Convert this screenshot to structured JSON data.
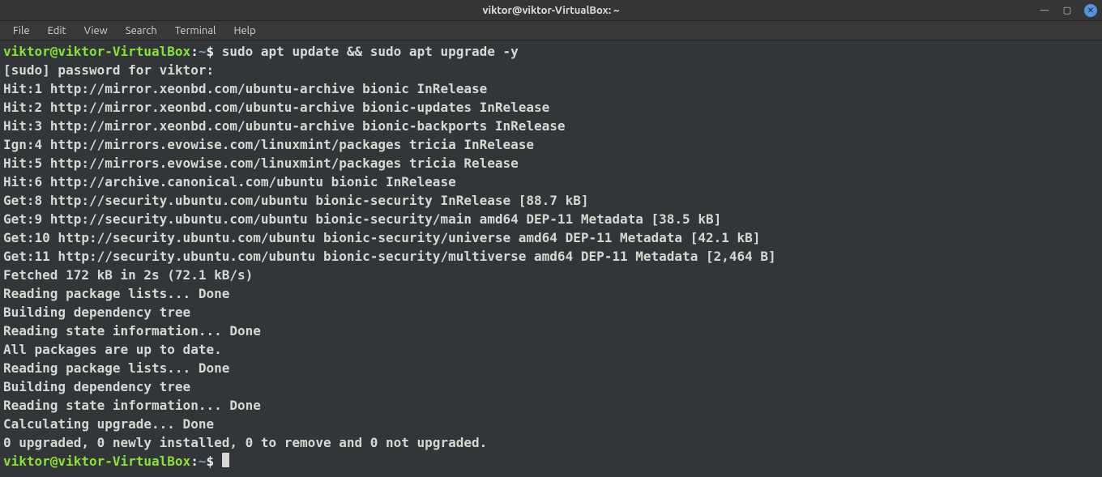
{
  "window": {
    "title": "viktor@viktor-VirtualBox: ~",
    "controls": {
      "minimize": "—",
      "maximize": "▢",
      "close": "✕"
    }
  },
  "menubar": [
    "File",
    "Edit",
    "View",
    "Search",
    "Terminal",
    "Help"
  ],
  "prompt": {
    "userhost": "viktor@viktor-VirtualBox",
    "colon": ":",
    "cwd": "~",
    "symbol": "$"
  },
  "command": "sudo apt update && sudo apt upgrade -y",
  "output": [
    "[sudo] password for viktor:",
    "Hit:1 http://mirror.xeonbd.com/ubuntu-archive bionic InRelease",
    "Hit:2 http://mirror.xeonbd.com/ubuntu-archive bionic-updates InRelease",
    "Hit:3 http://mirror.xeonbd.com/ubuntu-archive bionic-backports InRelease",
    "Ign:4 http://mirrors.evowise.com/linuxmint/packages tricia InRelease",
    "Hit:5 http://mirrors.evowise.com/linuxmint/packages tricia Release",
    "Hit:6 http://archive.canonical.com/ubuntu bionic InRelease",
    "Get:8 http://security.ubuntu.com/ubuntu bionic-security InRelease [88.7 kB]",
    "Get:9 http://security.ubuntu.com/ubuntu bionic-security/main amd64 DEP-11 Metadata [38.5 kB]",
    "Get:10 http://security.ubuntu.com/ubuntu bionic-security/universe amd64 DEP-11 Metadata [42.1 kB]",
    "Get:11 http://security.ubuntu.com/ubuntu bionic-security/multiverse amd64 DEP-11 Metadata [2,464 B]",
    "Fetched 172 kB in 2s (72.1 kB/s)",
    "Reading package lists... Done",
    "Building dependency tree",
    "Reading state information... Done",
    "All packages are up to date.",
    "Reading package lists... Done",
    "Building dependency tree",
    "Reading state information... Done",
    "Calculating upgrade... Done",
    "0 upgraded, 0 newly installed, 0 to remove and 0 not upgraded."
  ]
}
